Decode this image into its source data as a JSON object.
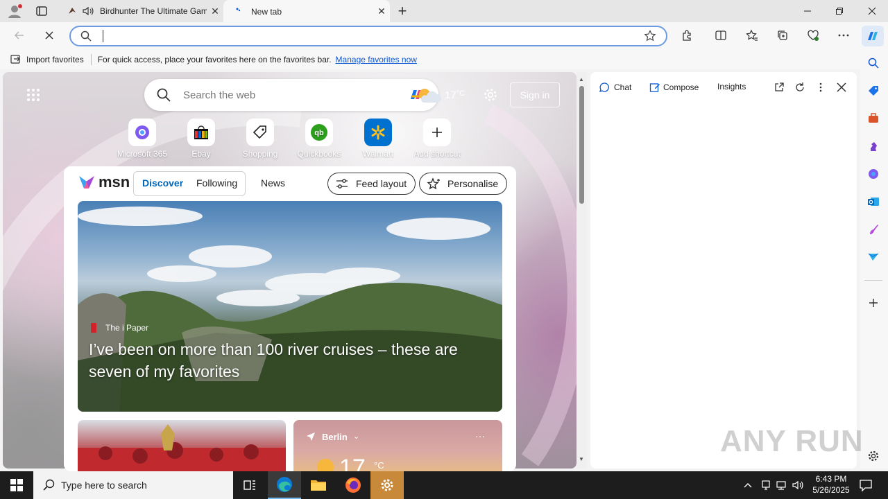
{
  "browser": {
    "tabs": [
      {
        "label": "Birdhunter The Ultimate Game"
      },
      {
        "label": "New tab"
      }
    ],
    "address": {
      "value": "",
      "placeholder": ""
    },
    "favorites_bar": {
      "import_label": "Import favorites",
      "message": "For quick access, place your favorites here on the favorites bar.",
      "manage_link": "Manage favorites now"
    }
  },
  "newtab": {
    "search_placeholder": "Search the web",
    "weather_temp": "17",
    "weather_unit": "°C",
    "sign_in": "Sign in",
    "shortcuts": [
      {
        "label": "Microsoft 365"
      },
      {
        "label": "Ebay"
      },
      {
        "label": "Shopping"
      },
      {
        "label": "Quickbooks"
      },
      {
        "label": "Walmart"
      },
      {
        "label": "Add shortcut"
      }
    ],
    "feed": {
      "logo_text": "msn",
      "tabs": [
        "Discover",
        "Following",
        "News"
      ],
      "feed_layout": "Feed layout",
      "personalise": "Personalise",
      "hero": {
        "source": "The i Paper",
        "headline": "I’ve been on more than 100 river cruises – these are seven of my favorites"
      },
      "weather_card": {
        "city": "Berlin",
        "temp": "17",
        "unit": "°C"
      }
    }
  },
  "side_panel": {
    "tabs": [
      "Chat",
      "Compose",
      "Insights"
    ]
  },
  "taskbar": {
    "search_placeholder": "Type here to search",
    "time": "6:43 PM",
    "date": "5/26/2025"
  },
  "watermark": "ANY RUN",
  "colors": {
    "accent": "#0b57d0",
    "msn_active": "#0067b8",
    "taskbar": "#1d1d1d"
  }
}
